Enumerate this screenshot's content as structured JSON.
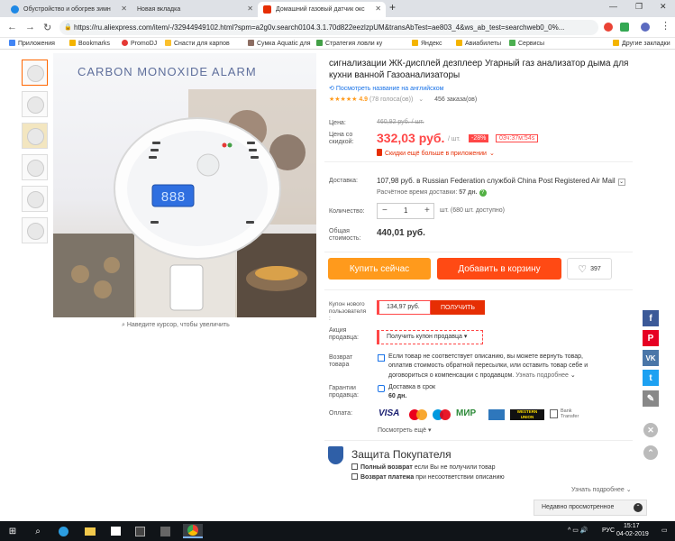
{
  "tabs": [
    {
      "title": "Обустройство и обогрев зимн"
    },
    {
      "title": "Новая вкладка"
    },
    {
      "title": "Домашний газовый датчик окс"
    }
  ],
  "address": {
    "url": "https://ru.aliexpress.com/item/-/32944949102.html?spm=a2g0v.search0104.3.1.70d822eezlzpUM&transAbTest=ae803_4&ws_ab_test=searchweb0_0%..."
  },
  "bookmarks": [
    "Приложения",
    "Bookmarks",
    "PromoDJ",
    "Снасти для карпов",
    "Сумка Aquatic для",
    "Стратегия ловли ку",
    "Яндекс",
    "Авиабилеты",
    "Сервисы",
    "Другие закладки"
  ],
  "product": {
    "image_title": "CARBON MONOXIDE ALARM",
    "lcd": "888",
    "zoom_hint": "Наведите курсор, чтобы увеличить",
    "title_line1": "сигнализации ЖК-дисплей дезплеер Угарный газ анализатор дыма для",
    "title_line2": "кухни ванной Газоанализаторы",
    "translate_link": "Посмотреть название на английском",
    "stars": "★★★★★",
    "rating": "4.9",
    "votes": "(78 голоса(ов))",
    "orders": "456 заказа(ов)"
  },
  "price": {
    "label": "Цена:",
    "old": "460,92 руб. / шт.",
    "discount_label_1": "Цена со",
    "discount_label_2": "скидкой:",
    "current": "332,03 руб.",
    "per": "/ шт.",
    "badge": "-28%",
    "timer": "03ч:37м:54s",
    "more_discounts": "Скидки ещё больше в приложении"
  },
  "delivery": {
    "label": "Доставка:",
    "text": "107,98 руб. в Russian Federation службой China Post Registered Air Mail",
    "time_label": "Расчётное время доставки:",
    "days": "57 дн."
  },
  "quantity": {
    "label": "Количество:",
    "value": "1",
    "note": "шт. (680 шт. доступно)",
    "minus": "−",
    "plus": "+"
  },
  "total": {
    "label_1": "Общая",
    "label_2": "стоимость:",
    "value": "440,01 руб."
  },
  "actions": {
    "buy": "Купить сейчас",
    "cart": "Добавить в корзину",
    "wishlist_count": "397"
  },
  "coupon": {
    "label_1": "Купон нового",
    "label_2": "пользователя",
    "label_3": ":",
    "amount": "134,97 руб.",
    "get": "ПОЛУЧИТЬ",
    "promo_label_1": "Акция",
    "promo_label_2": "продавца:",
    "promo_button": "Получить купон продавца"
  },
  "return": {
    "label_1": "Возврат",
    "label_2": "товара",
    "line1": "Если товар не соответствует описанию, вы можете вернуть товар,",
    "line2": "оплатив стоимость обратной пересылки, или оставить товар себе и",
    "line3": "договориться о компенсации с продавцом.",
    "more": "Узнать подробнее"
  },
  "guarantee": {
    "label_1": "Гарантии",
    "label_2": "продавца:",
    "line1": "Доставка в срок",
    "line2": "60 дн."
  },
  "payment": {
    "label": "Оплата:",
    "methods": [
      "VISA",
      "MasterCard",
      "Maestro",
      "МИР",
      "AmEx",
      "WESTERN UNION",
      "Bank Transfer"
    ],
    "see_all": "Посмотреть ещё"
  },
  "protection": {
    "title": "Защита Покупателя",
    "item1_bold": "Полный возврат",
    "item1_rest": "если Вы не получили товар",
    "item2_bold": "Возврат платежа",
    "item2_rest": "при несоответствии описанию",
    "more": "Узнать подробнее"
  },
  "recently_viewed": "Недавно просмотренное",
  "taskbar": {
    "lang": "РУС",
    "time": "15:17",
    "date": "04-02-2019"
  },
  "colors": {
    "accent": "#ff4747",
    "buy": "#ff9a1c",
    "cart": "#ff4a14"
  }
}
